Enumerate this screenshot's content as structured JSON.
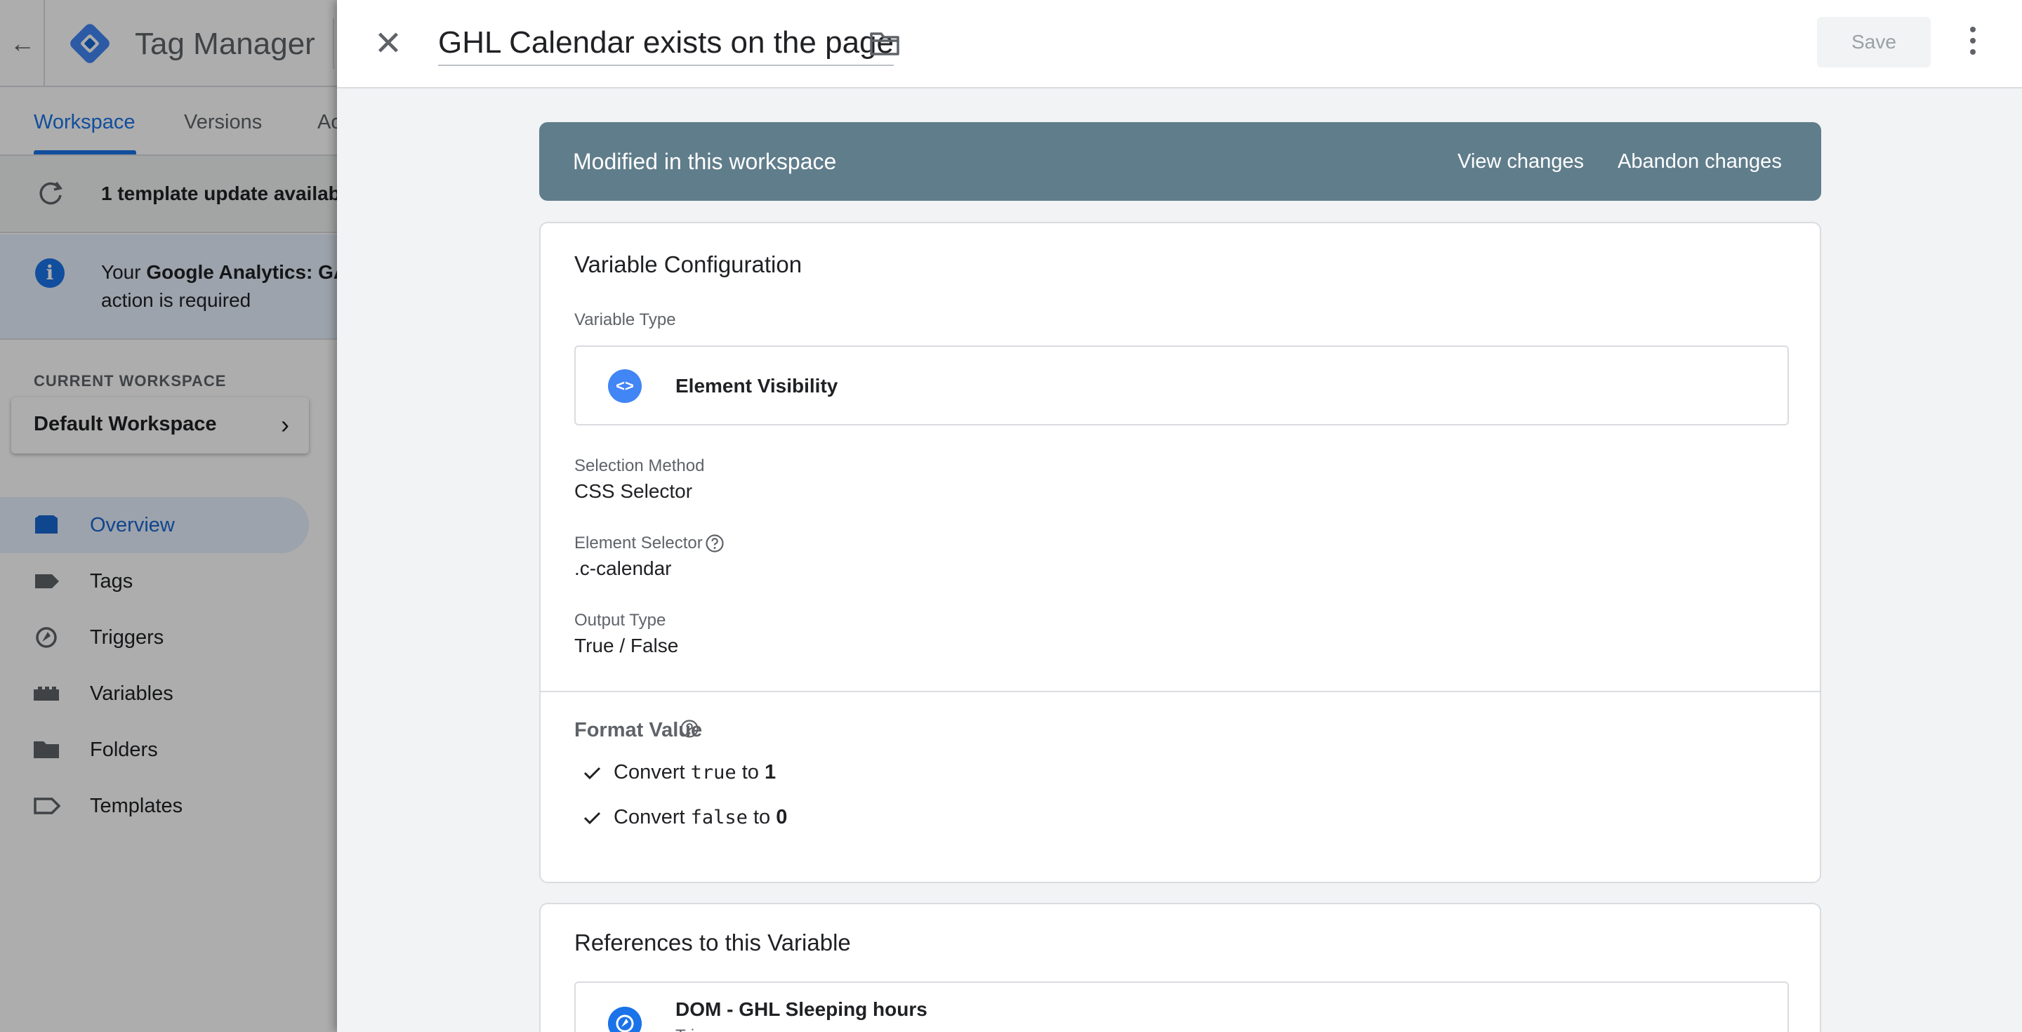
{
  "app": {
    "product_name": "Tag Manager",
    "tabs": [
      {
        "label": "Workspace",
        "active": true
      },
      {
        "label": "Versions",
        "active": false
      },
      {
        "label": "Ac",
        "active": false
      }
    ],
    "update_banner": "1 template update availab",
    "info_banner": {
      "line1_prefix": "Your ",
      "line1_bold": "Google Analytics: GA",
      "line2": "action is required"
    },
    "current_workspace_label": "CURRENT WORKSPACE",
    "workspace_name": "Default Workspace",
    "nav": [
      {
        "label": "Overview",
        "icon": "overview-icon",
        "active": true
      },
      {
        "label": "Tags",
        "icon": "tag-icon",
        "active": false
      },
      {
        "label": "Triggers",
        "icon": "trigger-icon",
        "active": false
      },
      {
        "label": "Variables",
        "icon": "variables-icon",
        "active": false
      },
      {
        "label": "Folders",
        "icon": "folder-icon",
        "active": false
      },
      {
        "label": "Templates",
        "icon": "template-icon",
        "active": false
      }
    ]
  },
  "panel": {
    "title": "GHL Calendar exists on the page",
    "save_label": "Save",
    "banner": {
      "text": "Modified in this workspace",
      "view_changes": "View changes",
      "abandon_changes": "Abandon changes"
    },
    "config": {
      "title": "Variable Configuration",
      "variable_type_label": "Variable Type",
      "variable_type_icon": "<>",
      "variable_type": "Element Visibility",
      "selection_method_label": "Selection Method",
      "selection_method": "CSS Selector",
      "element_selector_label": "Element Selector",
      "element_selector": ".c-calendar",
      "output_type_label": "Output Type",
      "output_type": "True / False",
      "format_value_label": "Format Value",
      "convert_true": {
        "prefix": "Convert ",
        "code": "true",
        "middle": " to ",
        "value": "1"
      },
      "convert_false": {
        "prefix": "Convert ",
        "code": "false",
        "middle": " to ",
        "value": "0"
      }
    },
    "references": {
      "title": "References to this Variable",
      "items": [
        {
          "name": "DOM - GHL Sleeping hours",
          "type": "Trigger"
        }
      ]
    }
  },
  "colors": {
    "accent": "#1a73e8",
    "banner": "#607d8b",
    "panel_bg": "#f1f3f4"
  }
}
